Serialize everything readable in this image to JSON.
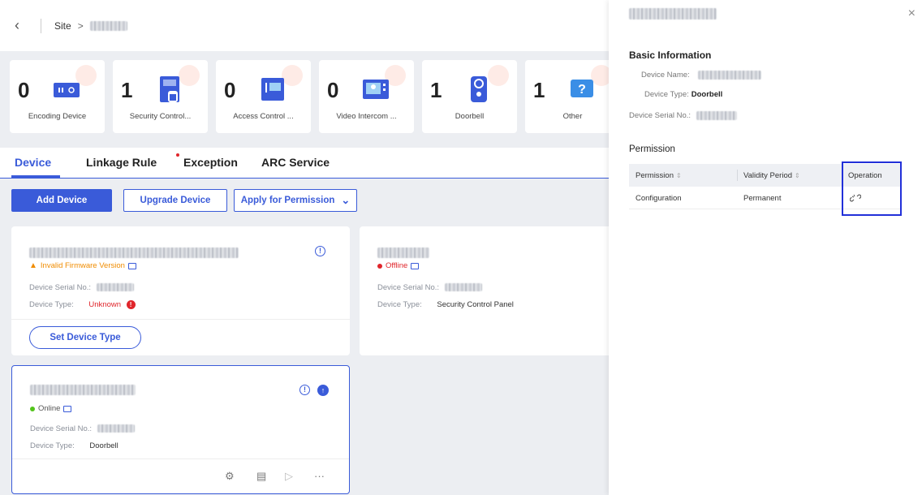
{
  "header": {
    "back_icon": "‹",
    "breadcrumb_site": "Site",
    "breadcrumb_arrow": ">"
  },
  "stats": [
    {
      "count": "0",
      "label": "Encoding Device",
      "icon": "encoder-icon"
    },
    {
      "count": "1",
      "label": "Security Control...",
      "icon": "control-panel-icon"
    },
    {
      "count": "0",
      "label": "Access Control ...",
      "icon": "access-control-icon"
    },
    {
      "count": "0",
      "label": "Video Intercom ...",
      "icon": "video-intercom-icon"
    },
    {
      "count": "1",
      "label": "Doorbell",
      "icon": "doorbell-icon"
    },
    {
      "count": "1",
      "label": "Other",
      "icon": "question-icon"
    }
  ],
  "tabs": [
    {
      "label": "Device",
      "active": true
    },
    {
      "label": "Linkage Rule",
      "active": false
    },
    {
      "label": "Exception",
      "active": false
    },
    {
      "label": "ARC Service",
      "active": false
    }
  ],
  "toolbar": {
    "add_device": "Add Device",
    "upgrade_device": "Upgrade Device",
    "apply_permission": "Apply for Permission",
    "dropdown_icon": "⌄"
  },
  "devices": [
    {
      "status": "Invalid Firmware Version",
      "serial_label": "Device Serial No.:",
      "type_label": "Device Type:",
      "type_value": "Unknown",
      "action": "Set Device Type"
    },
    {
      "status": "Offline",
      "serial_label": "Device Serial No.:",
      "type_label": "Device Type:",
      "type_value": "Security Control Panel"
    },
    {
      "status": "Online",
      "serial_label": "Device Serial No.:",
      "type_label": "Device Type:",
      "type_value": "Doorbell"
    }
  ],
  "panel": {
    "close_icon": "×",
    "basic_title": "Basic Information",
    "device_name_label": "Device Name:",
    "device_type_label": "Device Type:",
    "device_type_value": "Doorbell",
    "serial_label": "Device Serial No.:",
    "permission_title": "Permission",
    "table": {
      "headers": [
        "Permission",
        "Validity Period",
        "Operation"
      ],
      "sort_icon": "⇕",
      "rows": [
        {
          "permission": "Configuration",
          "validity": "Permanent",
          "operation_icon": "unlink-icon"
        }
      ]
    }
  },
  "colors": {
    "accent": "#3a5bd9",
    "warning": "#f08c00",
    "offline": "#e0252b",
    "online": "#52c41a",
    "highlight": "#2230d9"
  }
}
